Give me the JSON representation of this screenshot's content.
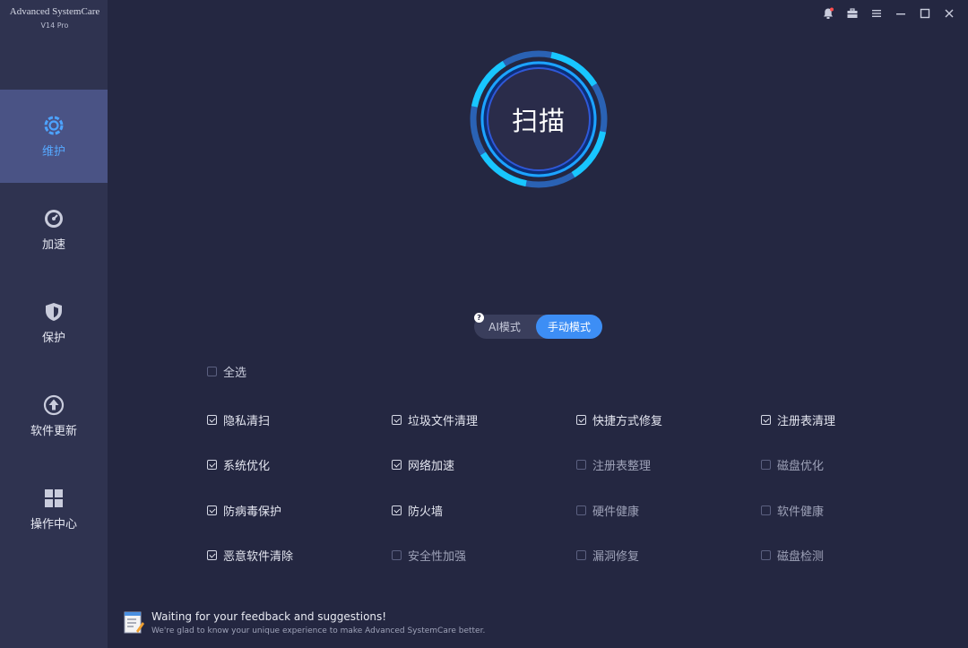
{
  "brand": {
    "name": "Advanced SystemCare",
    "version": "V14 Pro"
  },
  "sidebar": {
    "items": [
      {
        "label": "维护",
        "icon": "maintenance-icon",
        "active": true
      },
      {
        "label": "加速",
        "icon": "speedometer-icon",
        "active": false
      },
      {
        "label": "保护",
        "icon": "shield-icon",
        "active": false
      },
      {
        "label": "软件更新",
        "icon": "update-arrow-icon",
        "active": false
      },
      {
        "label": "操作中心",
        "icon": "grid-icon",
        "active": false
      }
    ]
  },
  "window_controls": [
    "notification-bell-icon",
    "toolbox-icon",
    "menu-icon",
    "minimize-icon",
    "maximize-icon",
    "close-icon"
  ],
  "scan": {
    "label": "扫描"
  },
  "mode": {
    "ai_label": "AI模式",
    "manual_label": "手动模式",
    "selected": "手动模式",
    "help": "?"
  },
  "select_all": {
    "label": "全选",
    "checked": false
  },
  "options": [
    {
      "label": "隐私清扫",
      "checked": true
    },
    {
      "label": "垃圾文件清理",
      "checked": true
    },
    {
      "label": "快捷方式修复",
      "checked": true
    },
    {
      "label": "注册表清理",
      "checked": true
    },
    {
      "label": "系统优化",
      "checked": true
    },
    {
      "label": "网络加速",
      "checked": true
    },
    {
      "label": "注册表整理",
      "checked": false
    },
    {
      "label": "磁盘优化",
      "checked": false
    },
    {
      "label": "防病毒保护",
      "checked": true
    },
    {
      "label": "防火墙",
      "checked": true
    },
    {
      "label": "硬件健康",
      "checked": false
    },
    {
      "label": "软件健康",
      "checked": false
    },
    {
      "label": "恶意软件清除",
      "checked": true
    },
    {
      "label": "安全性加强",
      "checked": false
    },
    {
      "label": "漏洞修复",
      "checked": false
    },
    {
      "label": "磁盘检测",
      "checked": false
    }
  ],
  "feedback": {
    "title": "Waiting for your feedback and suggestions!",
    "subtitle": "We're glad to know your unique experience to make Advanced SystemCare better."
  },
  "colors": {
    "accent": "#3d8ef5",
    "ring": "#1ec8ff",
    "sidebar_active": "#4a5385",
    "background": "#242741"
  }
}
